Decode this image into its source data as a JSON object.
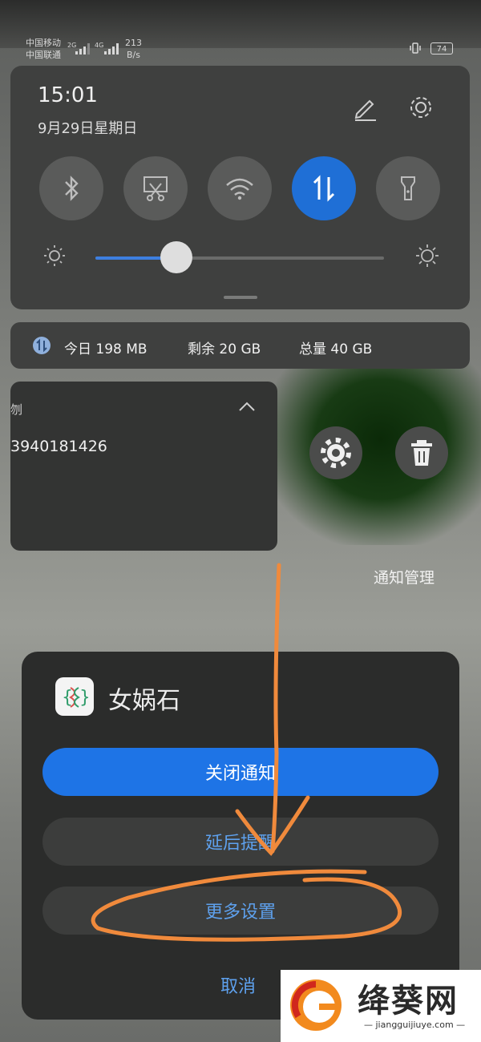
{
  "status_bar": {
    "carrier1": "中国移动",
    "carrier2": "中国联通",
    "net1": "2G",
    "net2": "4G",
    "speed_value": "213",
    "speed_unit": "B/s",
    "battery": "74"
  },
  "quick_settings": {
    "time": "15:01",
    "date": "9月29日星期日",
    "tiles": [
      {
        "name": "bluetooth",
        "active": false
      },
      {
        "name": "screenshot",
        "active": false
      },
      {
        "name": "wifi",
        "active": false
      },
      {
        "name": "mobile-data",
        "active": true
      },
      {
        "name": "flashlight",
        "active": false
      }
    ],
    "brightness_level": 0.28
  },
  "data_usage": {
    "today": "今日 198 MB",
    "remaining": "剩余 20 GB",
    "total": "总量 40 GB"
  },
  "notification": {
    "title_fragment": "刎",
    "number_fragment": "3940181426",
    "manage_label": "通知管理"
  },
  "dialog": {
    "app_name": "女娲石",
    "buttons": {
      "close": "关闭通知",
      "snooze": "延后提醒",
      "more": "更多设置",
      "cancel": "取消"
    }
  },
  "watermark": {
    "name": "绛葵网",
    "url": "— jiangguijiuye.com —"
  },
  "colors": {
    "accent_blue": "#1e74e6",
    "link_blue": "#5ea1ee",
    "annotation_orange": "#f08a3c"
  }
}
